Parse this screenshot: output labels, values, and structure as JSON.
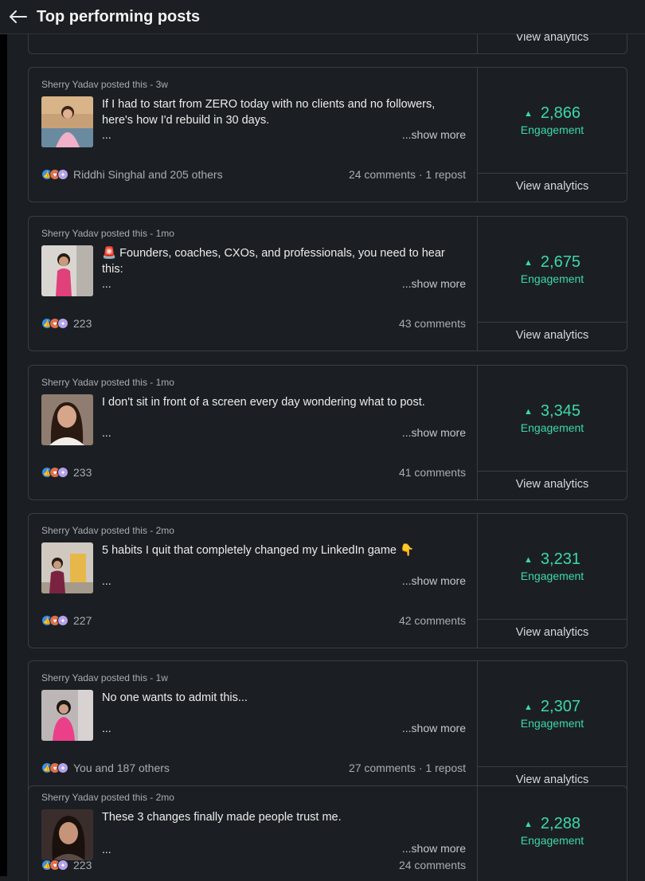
{
  "header": {
    "title": "Top performing posts"
  },
  "common": {
    "view_analytics": "View analytics",
    "engagement_label": "Engagement",
    "show_more": "...show more",
    "ellipsis": "..."
  },
  "posts": [
    {
      "meta": "Sherry Yadav posted this - 3w",
      "text": "If I had to start from ZERO today with no clients and no followers, here's how I'd rebuild in 30 days.",
      "reactions": "Riddhi Singhal and 205 others",
      "counts": "24 comments · 1 repost",
      "engagement": "2,866"
    },
    {
      "meta": "Sherry Yadav posted this - 1mo",
      "text": "🚨 Founders, coaches, CXOs, and professionals, you need to hear this:",
      "reactions": "223",
      "counts": "43 comments",
      "engagement": "2,675"
    },
    {
      "meta": "Sherry Yadav posted this - 1mo",
      "text": "I don't sit in front of a screen every day wondering what to post.",
      "reactions": "233",
      "counts": "41 comments",
      "engagement": "3,345"
    },
    {
      "meta": "Sherry Yadav posted this - 2mo",
      "text": "5 habits I quit that completely changed my LinkedIn game 👇",
      "reactions": "227",
      "counts": "42 comments",
      "engagement": "3,231"
    },
    {
      "meta": "Sherry Yadav posted this - 1w",
      "text": "No one wants to admit this...",
      "reactions": "You and 187 others",
      "counts": "27 comments · 1 repost",
      "engagement": "2,307"
    },
    {
      "meta": "Sherry Yadav posted this - 2mo",
      "text": "These 3 changes finally made people trust me.",
      "reactions": "223",
      "counts": "24 comments",
      "engagement": "2,288"
    }
  ],
  "colors": {
    "accent": "#3dd9a8",
    "background": "#1b1f23",
    "border": "#3a3e44"
  },
  "icons": {
    "back": "arrow-left-icon",
    "like": "like-icon",
    "love": "love-icon",
    "insightful": "insightful-icon"
  }
}
